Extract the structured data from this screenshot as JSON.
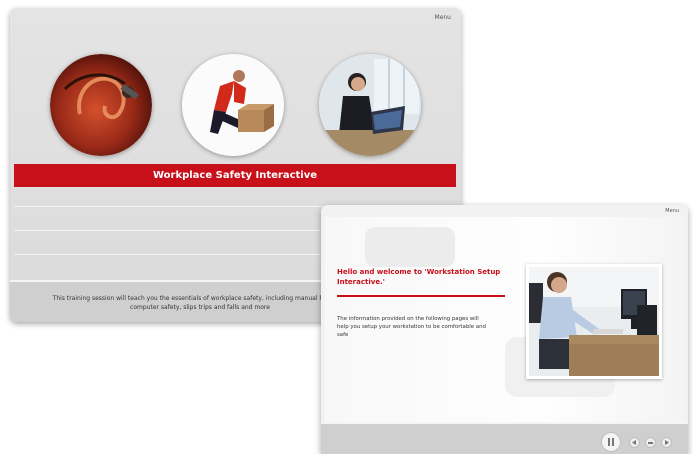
{
  "back_window": {
    "menu_label": "Menu",
    "banner_title": "Workplace Safety Interactive",
    "description": "This training session will teach you the essentials of workplace safety, including manual handling, computer safety, slips trips and falls and more",
    "images": [
      {
        "icon": "ear-closeup-icon"
      },
      {
        "icon": "person-lifting-box-icon"
      },
      {
        "icon": "person-at-laptop-icon"
      }
    ]
  },
  "front_window": {
    "menu_label": "Menu",
    "headline": "Hello and welcome to 'Workstation Setup Interactive.'",
    "body": "The information provided on the following pages will help you setup your workstation to be comfortable and safe",
    "photo": {
      "icon": "man-at-computer-desk-icon"
    },
    "controls": [
      {
        "icon": "pause-icon"
      },
      {
        "icon": "previous-icon"
      },
      {
        "icon": "menu-dots-icon"
      },
      {
        "icon": "next-icon"
      }
    ]
  },
  "colors": {
    "accent_red": "#c8101a",
    "panel_gray": "#dadada",
    "footer_gray": "#cfcfcf"
  }
}
